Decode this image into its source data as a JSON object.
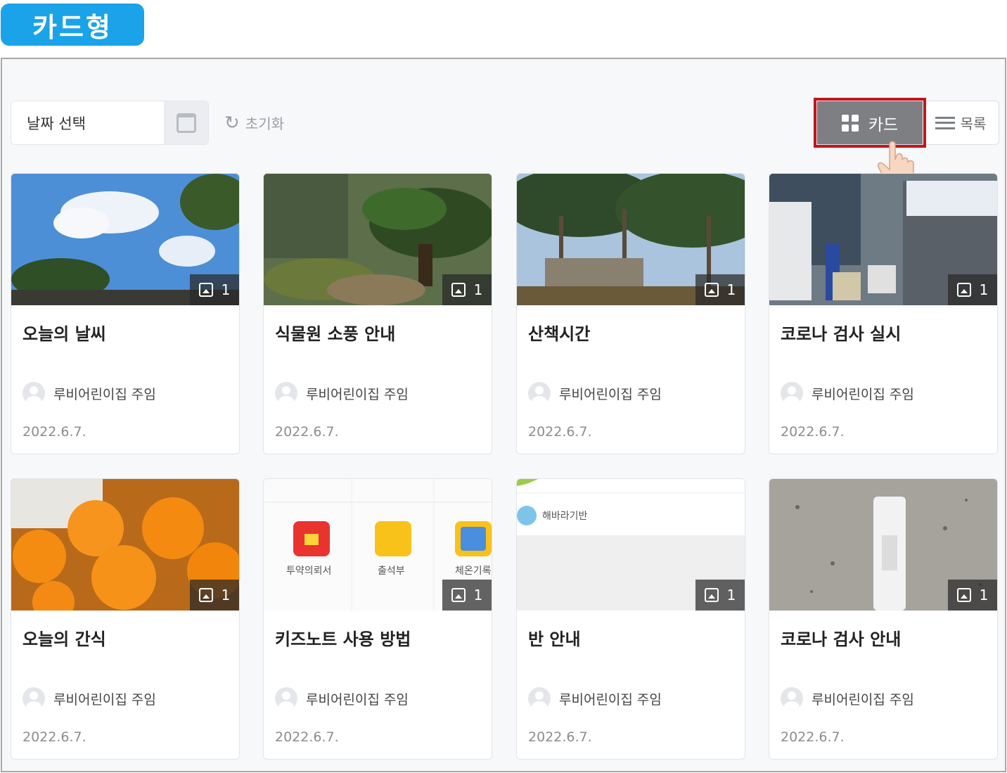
{
  "badge": {
    "label": "카드형"
  },
  "toolbar": {
    "date_placeholder": "날짜 선택",
    "reset_label": "초기화",
    "card_view_label": "카드",
    "list_view_label": "목록"
  },
  "cards": [
    {
      "title": "오늘의 날씨",
      "author": "루비어린이집 주임",
      "date": "2022.6.7.",
      "image_count": "1"
    },
    {
      "title": "식물원 소풍 안내",
      "author": "루비어린이집 주임",
      "date": "2022.6.7.",
      "image_count": "1"
    },
    {
      "title": "산책시간",
      "author": "루비어린이집 주임",
      "date": "2022.6.7.",
      "image_count": "1"
    },
    {
      "title": "코로나 검사 실시",
      "author": "루비어린이집 주임",
      "date": "2022.6.7.",
      "image_count": "1"
    },
    {
      "title": "오늘의 간식",
      "author": "루비어린이집 주임",
      "date": "2022.6.7.",
      "image_count": "1"
    },
    {
      "title": "키즈노트 사용 방법",
      "author": "루비어린이집 주임",
      "date": "2022.6.7.",
      "image_count": "1",
      "app_labels": [
        "투약의뢰서",
        "출석부",
        "체온기록"
      ]
    },
    {
      "title": "반 안내",
      "author": "루비어린이집 주임",
      "date": "2022.6.7.",
      "image_count": "1",
      "class_name": "해바라기반"
    },
    {
      "title": "코로나 검사 안내",
      "author": "루비어린이집 주임",
      "date": "2022.6.7.",
      "image_count": "1"
    }
  ],
  "colors": {
    "badge": "#1aa3e8",
    "active_toggle": "#7d7f82",
    "highlight": "#c0161b"
  }
}
